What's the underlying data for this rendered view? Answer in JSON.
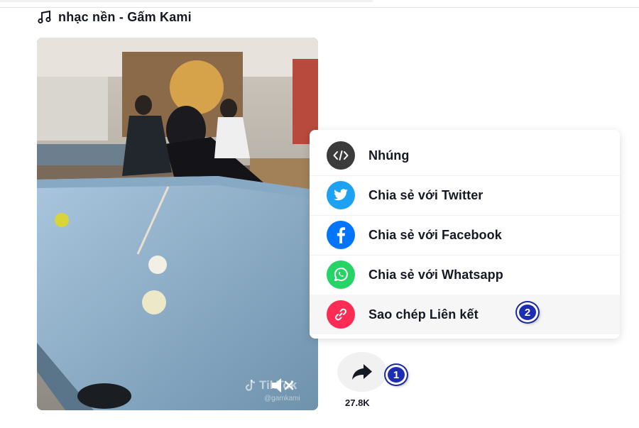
{
  "header": {
    "music_icon": "music-note-icon",
    "music_label": "nhạc nền - Gấm Kami"
  },
  "video": {
    "watermark_brand": "TikTok",
    "watermark_user": "@gamkami",
    "mute_icon": "speaker-muted-icon"
  },
  "share_menu": {
    "items": [
      {
        "label": "Nhúng",
        "icon": "embed-code-icon",
        "color": "#444444"
      },
      {
        "label": "Chia sẻ với Twitter",
        "icon": "twitter-icon",
        "color": "#1da1f2"
      },
      {
        "label": "Chia sẻ với Facebook",
        "icon": "facebook-icon",
        "color": "#0075fa"
      },
      {
        "label": "Chia sẻ với Whatsapp",
        "icon": "whatsapp-icon",
        "color": "#25d366"
      },
      {
        "label": "Sao chép Liên kết",
        "icon": "link-icon",
        "color": "#fe2c55"
      }
    ]
  },
  "annotations": {
    "badge_1": "1",
    "badge_2": "2"
  },
  "share": {
    "icon": "share-arrow-icon",
    "count": "27.8K"
  },
  "colors": {
    "badge": "#1d2db3",
    "text": "#161823"
  }
}
